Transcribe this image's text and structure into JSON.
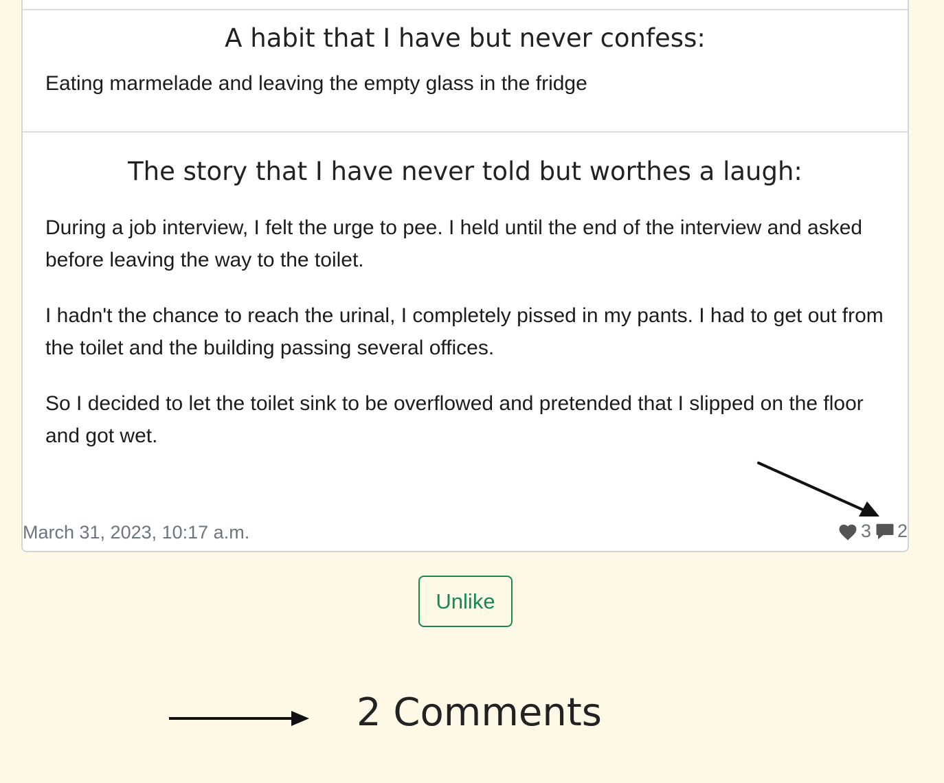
{
  "post": {
    "sections": [
      {
        "title": "A habit that I have but never confess:",
        "paragraphs": [
          "Eating marmelade and leaving the empty glass in the fridge"
        ]
      },
      {
        "title": "The story that I have never told but worthes a laugh:",
        "paragraphs": [
          "During a job interview, I felt the urge to pee. I held until the end of the interview and asked before leaving the way to the toilet.",
          "I hadn't the chance to reach the urinal, I completely pissed in my pants. I had to get out from the toilet and the building passing several offices.",
          "So I decided to let the toilet sink to be overflowed and pretended that I slipped on the floor and got wet."
        ]
      }
    ],
    "footer": {
      "date": "March 31, 2023, 10:17 a.m.",
      "likes": "3",
      "comments": "2",
      "like_icon": "heart-icon",
      "comment_icon": "comment-icon"
    }
  },
  "actions": {
    "unlike_label": "Unlike"
  },
  "comments": {
    "heading": "2 Comments"
  },
  "colors": {
    "background": "#fdf9e6",
    "accent_green": "#198754",
    "muted": "#6c757d"
  }
}
